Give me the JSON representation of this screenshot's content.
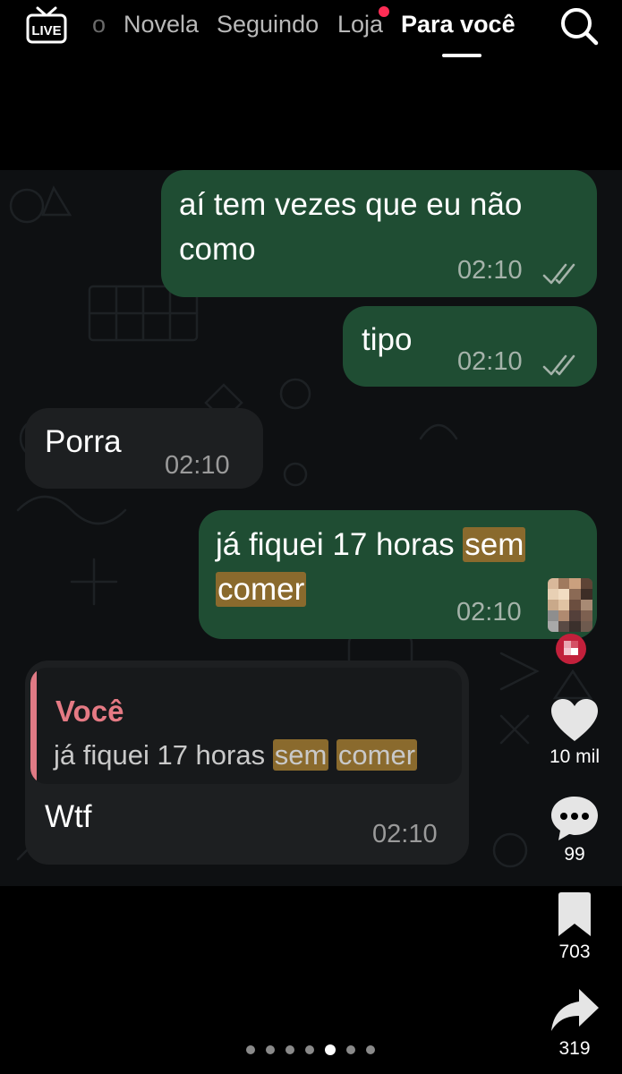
{
  "top_nav": {
    "live_label": "LIVE",
    "partial_tab": "o",
    "tabs": [
      "Novela",
      "Seguindo",
      "Loja",
      "Para você"
    ],
    "active_tab": "Para você",
    "loja_has_notification": true
  },
  "icons": {
    "live": "live-tv-icon",
    "search": "search-icon",
    "like": "heart-icon",
    "comment": "comment-icon",
    "save": "bookmark-icon",
    "share": "share-icon",
    "read_receipt": "double-check-icon"
  },
  "chat": {
    "messages": [
      {
        "direction": "outgoing",
        "line1": "aí tem vezes que eu não",
        "line2": "como",
        "time": "02:10"
      },
      {
        "direction": "outgoing",
        "text": "tipo",
        "time": "02:10"
      },
      {
        "direction": "incoming",
        "text": "Porra",
        "time": "02:10"
      },
      {
        "direction": "outgoing",
        "part1": "já fiquei 17 horas ",
        "highlight1": "sem",
        "highlight2": "comer",
        "time": "02:10"
      },
      {
        "direction": "incoming",
        "quoted_author": "Você",
        "quoted_text": "já fiquei 17 horas ",
        "quoted_highlight1": "sem",
        "quoted_highlight2": "comer",
        "text": "Wtf",
        "time": "02:10"
      }
    ]
  },
  "actions": {
    "likes": "10 mil",
    "comments": "99",
    "saves": "703",
    "shares": "319"
  },
  "carousel": {
    "total": 7,
    "current": 5
  },
  "colors": {
    "outgoing_bubble": "#1f4d33",
    "incoming_bubble": "#1d1f21",
    "highlight": "#8a6a2d",
    "quote_accent": "#e07a85",
    "notification": "#ff2d55"
  }
}
